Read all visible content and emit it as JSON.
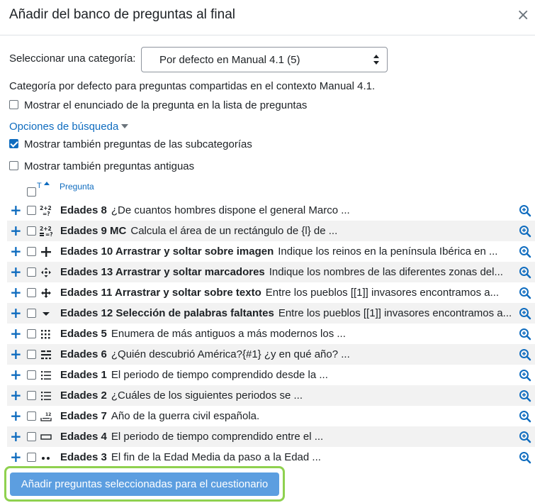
{
  "modal": {
    "title": "Añadir del banco de preguntas al final",
    "close_glyph": "×"
  },
  "category": {
    "label": "Seleccionar una categoría:",
    "selected": "Por defecto en Manual 4.1 (5)",
    "description": "Categoría por defecto para preguntas compartidas en el contexto Manual 4.1."
  },
  "options": {
    "show_text": {
      "label": "Mostrar el enunciado de la pregunta en la lista de preguntas",
      "checked": false
    },
    "search_options": "Opciones de búsqueda",
    "show_subcategories": {
      "label": "Mostrar también preguntas de las subcategorías",
      "checked": true
    },
    "show_old": {
      "label": "Mostrar también preguntas antiguas",
      "checked": false
    }
  },
  "table_header": {
    "type_col": "T",
    "question_col": "Pregunta"
  },
  "questions": [
    {
      "name": "Edades 8",
      "text": "¿De cuantos hombres dispone el general Marco ...",
      "type_icon": "calculated-icon"
    },
    {
      "name": "Edades 9 MC",
      "text": "Calcula el área de un rectángulo de {l} de ...",
      "type_icon": "calculated-multichoice-icon"
    },
    {
      "name": "Edades 10 Arrastrar y soltar sobre imagen",
      "text": "Indique los reinos en la península Ibérica en ...",
      "type_icon": "drag-drop-image-icon"
    },
    {
      "name": "Edades 13 Arrastrar y soltar marcadores",
      "text": "Indique los nombres de las diferentes zonas del...",
      "type_icon": "drag-drop-markers-icon"
    },
    {
      "name": "Edades 11 Arrastrar y soltar sobre texto",
      "text": "Entre los pueblos [[1]] invasores encontramos a...",
      "type_icon": "drag-drop-text-icon"
    },
    {
      "name": "Edades 12 Selección de palabras faltantes",
      "text": "Entre los pueblos [[1]] invasores encontramos a...",
      "type_icon": "select-missing-words-icon"
    },
    {
      "name": "Edades 5",
      "text": "Enumera de más antiguos a más modernos los ...",
      "type_icon": "ordering-icon"
    },
    {
      "name": "Edades 6",
      "text": "¿Quién descubrió América?{#1} ¿y en qué año? ...",
      "type_icon": "cloze-icon"
    },
    {
      "name": "Edades 1",
      "text": "El periodo de tiempo comprendido desde la ...",
      "type_icon": "multichoice-icon"
    },
    {
      "name": "Edades 2",
      "text": "¿Cuáles de los siguientes periodos se ...",
      "type_icon": "multichoice-icon"
    },
    {
      "name": "Edades 7",
      "text": "Año de la guerra civil española.",
      "type_icon": "numerical-icon"
    },
    {
      "name": "Edades 4",
      "text": "El periodo de tiempo comprendido entre el ...",
      "type_icon": "short-answer-icon"
    },
    {
      "name": "Edades 3",
      "text": "El fin de la Edad Media da paso a la Edad ...",
      "type_icon": "true-false-icon"
    }
  ],
  "glyphs": {
    "add": "+",
    "calc": "2+2",
    "calc_q": "=?",
    "numerical": "12"
  },
  "submit": {
    "label": "Añadir preguntas seleccionadas para el cuestionario"
  },
  "colors": {
    "link": "#0f6cbf",
    "button": "#5c9ee0",
    "highlight_border": "#8fd14f",
    "row_alt": "#f2f2f2"
  }
}
